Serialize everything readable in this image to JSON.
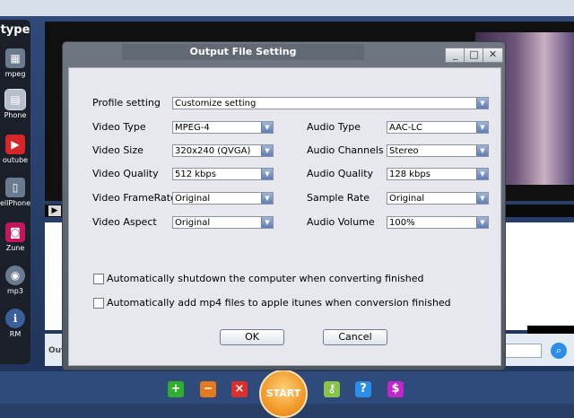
{
  "window": {
    "title": "Output File Setting"
  },
  "left_panel": {
    "title": "type",
    "items": [
      {
        "label": "mpeg",
        "icon": "film-icon"
      },
      {
        "label": "Phone",
        "icon": "phone-icon"
      },
      {
        "label": "outube",
        "icon": "youtube-icon"
      },
      {
        "label": "ellPhone",
        "icon": "cellphone-icon"
      },
      {
        "label": "Zune",
        "icon": "zune-icon"
      },
      {
        "label": "mp3",
        "icon": "mp3-icon"
      },
      {
        "label": "RM",
        "icon": "rm-icon"
      }
    ]
  },
  "background": {
    "out_label": "Out"
  },
  "form": {
    "profile_label": "Profile setting",
    "profile_value": "Customize setting",
    "video_type_label": "Video Type",
    "video_type_value": "MPEG-4",
    "video_size_label": "Video Size",
    "video_size_value": "320x240 (QVGA)",
    "video_quality_label": "Video Quality",
    "video_quality_value": "512 kbps",
    "video_framerate_label": "Video FrameRate",
    "video_framerate_value": "Original",
    "video_aspect_label": "Video Aspect",
    "video_aspect_value": "Original",
    "audio_type_label": "Audio Type",
    "audio_type_value": "AAC-LC",
    "audio_channels_label": "Audio Channels",
    "audio_channels_value": "Stereo",
    "audio_quality_label": "Audio Quality",
    "audio_quality_value": "128 kbps",
    "sample_rate_label": "Sample Rate",
    "sample_rate_value": "Original",
    "audio_volume_label": "Audio Volume",
    "audio_volume_value": "100%"
  },
  "options": {
    "shutdown_label": "Automatically shutdown the computer when converting finished",
    "itunes_label": "Automatically add mp4 files to apple itunes when conversion finished"
  },
  "buttons": {
    "ok": "OK",
    "cancel": "Cancel"
  },
  "toolbar": {
    "start": "START"
  },
  "colors": {
    "start": "#f19a2a",
    "add": "#2fae2f",
    "remove": "#e37a1e",
    "delete": "#d9302b",
    "key": "#8bc34a",
    "help": "#2b8ee8",
    "buy": "#c026c9"
  }
}
